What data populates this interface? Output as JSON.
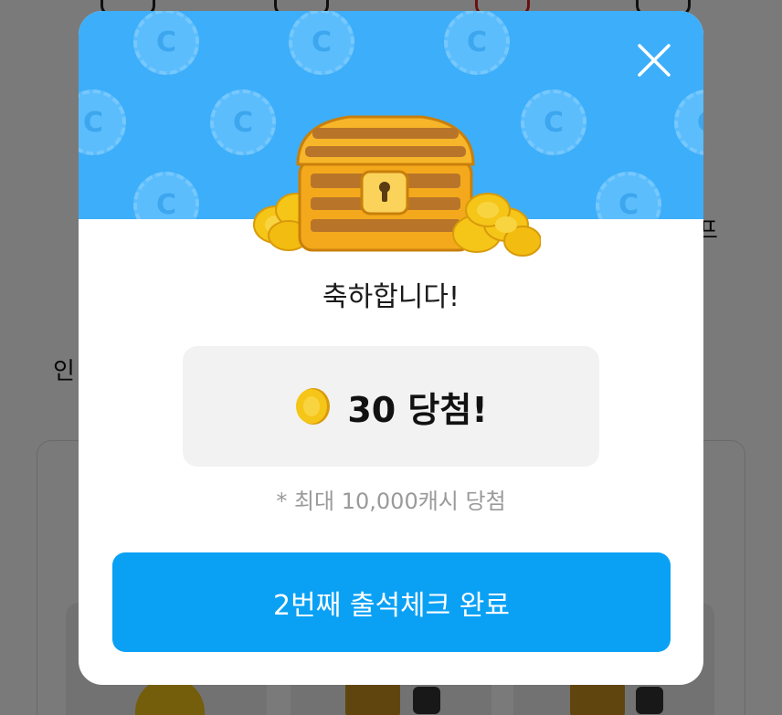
{
  "background": {
    "label_left": "인",
    "label_right": "프"
  },
  "modal": {
    "close_icon": "close-icon",
    "banner_icon": "treasure-chest-icon",
    "pattern_coin_glyph": "C",
    "title": "축하합니다!",
    "prize": {
      "icon": "coin-icon",
      "text": "30 당첨!"
    },
    "note": "* 최대 10,000캐시 당첨",
    "button_label": "2번째 출석체크 완료"
  },
  "colors": {
    "banner": "#3daef9",
    "button": "#0aa1f5",
    "coin": "#f5c518"
  }
}
